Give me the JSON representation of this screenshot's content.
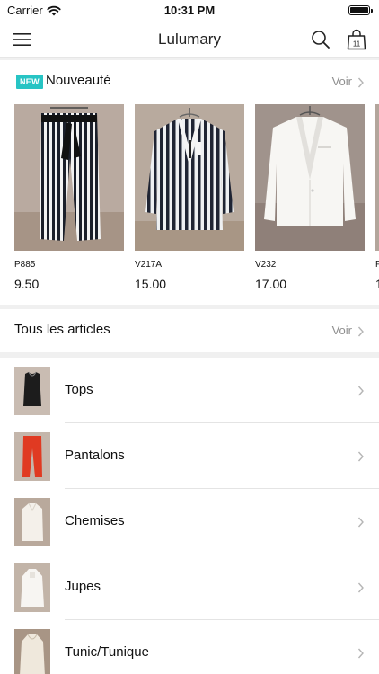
{
  "status_bar": {
    "carrier": "Carrier",
    "time": "10:31 PM"
  },
  "nav": {
    "title": "Lulumary",
    "cart_count": "11",
    "icons": [
      "menu-icon",
      "search-icon",
      "shopping-bag-icon"
    ]
  },
  "new_section": {
    "badge": "NEW",
    "title": "Nouveauté",
    "see_all": "Voir",
    "products": [
      {
        "code": "P885",
        "price": "9.50"
      },
      {
        "code": "V217A",
        "price": "15.00"
      },
      {
        "code": "V232",
        "price": "17.00"
      },
      {
        "code": "P",
        "price": "1"
      }
    ]
  },
  "all_section": {
    "title": "Tous les articles",
    "see_all": "Voir"
  },
  "categories": [
    {
      "label": "Tops"
    },
    {
      "label": "Pantalons"
    },
    {
      "label": "Chemises"
    },
    {
      "label": "Jupes"
    },
    {
      "label": "Tunic/Tunique"
    }
  ],
  "colors": {
    "badge": "#27c4c4",
    "muted": "#8e8e8e",
    "background": "#f0f0f0"
  }
}
